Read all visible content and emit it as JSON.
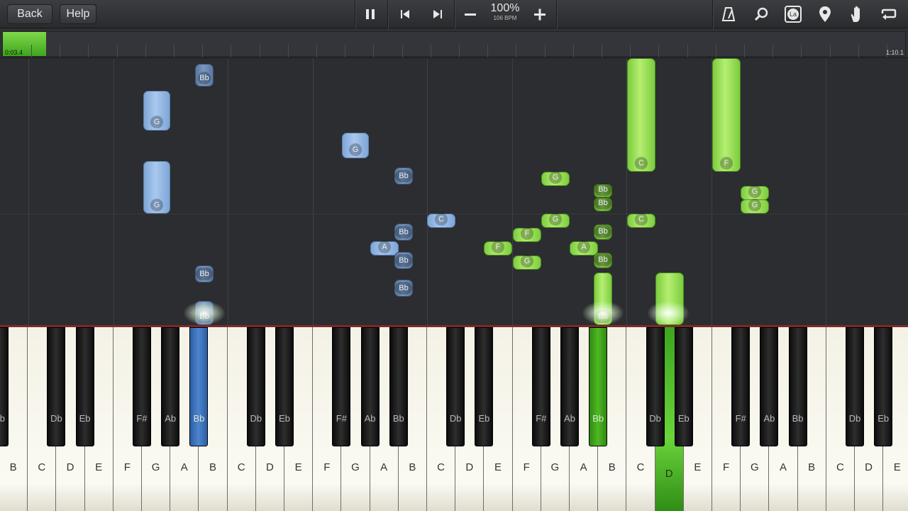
{
  "toolbar": {
    "back_label": "Back",
    "help_label": "Help",
    "speed_percent": "100%",
    "speed_bpm": "106 BPM",
    "icons": [
      "pause-icon",
      "skip-back-icon",
      "skip-forward-icon",
      "slower-icon",
      "faster-icon",
      "metronome-icon",
      "magnifier-icon",
      "note-labels-icon",
      "marker-icon",
      "hand-icon",
      "loop-icon"
    ],
    "note_labels_icon_text": "La"
  },
  "timeline": {
    "elapsed": "0:03.4",
    "total": "1:10.1",
    "progress_fraction": 0.048
  },
  "colors": {
    "left_hand": "#7ea6d6",
    "right_hand": "#8fdc4f",
    "background": "#2c2d30"
  },
  "notes": {
    "blue": [
      "Bb",
      "G",
      "G",
      "G",
      "Bb",
      "Bb",
      "A",
      "Bb",
      "C",
      "Bb",
      "Bb",
      "Bb"
    ],
    "green": [
      "C",
      "F",
      "G",
      "Bb",
      "Bb",
      "G",
      "F",
      "F",
      "G",
      "A",
      "Bb",
      "Bb",
      "Bb",
      "C",
      "G",
      "G"
    ]
  },
  "keyboard": {
    "white_keys": [
      "B",
      "C",
      "D",
      "E",
      "F",
      "G",
      "A",
      "B",
      "C",
      "D",
      "E",
      "F",
      "G",
      "A",
      "B",
      "C",
      "D",
      "E",
      "F",
      "G",
      "A",
      "B",
      "C",
      "D",
      "E",
      "F",
      "G",
      "A",
      "B",
      "C",
      "D",
      "E"
    ],
    "black_keys": [
      "Bb",
      "Db",
      "Eb",
      "F#",
      "Ab",
      "Bb",
      "Db",
      "Eb",
      "F#",
      "Ab",
      "Bb",
      "Db",
      "Eb",
      "F#",
      "Ab",
      "Bb",
      "Db",
      "Eb",
      "F#",
      "Ab",
      "Bb",
      "Db",
      "Eb"
    ],
    "pressed_white": "D",
    "pressed_black_left": "Bb",
    "pressed_black_right": "Bb"
  }
}
